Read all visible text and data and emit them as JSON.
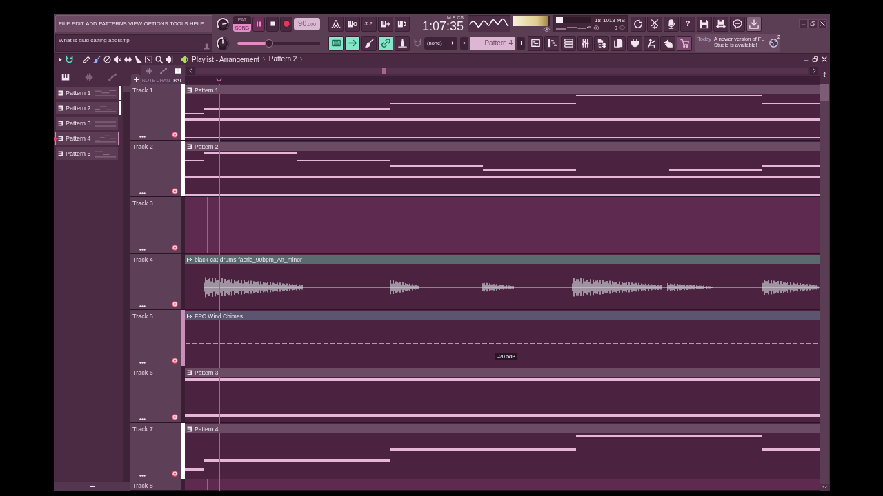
{
  "menu": [
    "FILE",
    "EDIT",
    "ADD",
    "PATTERNS",
    "VIEW",
    "OPTIONS",
    "TOOLS",
    "HELP"
  ],
  "hint_bar": {
    "text": "What is blud catting about.flp"
  },
  "knobs": [
    {
      "level": 0.8
    },
    {
      "level": 0.5
    }
  ],
  "transport": {
    "modes": [
      {
        "label": "PAT",
        "selected": false
      },
      {
        "label": "SONG",
        "selected": true
      }
    ],
    "tempo": {
      "whole": "90",
      "fraction": ".000"
    }
  },
  "pitch_slider": {
    "level": 0.38
  },
  "record_tools": [
    {
      "kind": "peak"
    },
    {
      "kind": "keys-loop"
    },
    {
      "kind": "countdown",
      "label": "3.2:"
    },
    {
      "kind": "keys-plus"
    },
    {
      "kind": "keys-cycle"
    }
  ],
  "toggles": [
    {
      "kind": "keyboard",
      "on": true
    },
    {
      "kind": "arrow",
      "on": true
    },
    {
      "kind": "brush",
      "on": false
    },
    {
      "kind": "link",
      "on": true
    },
    {
      "kind": "metronome",
      "on": false
    }
  ],
  "snap": {
    "value": "(none)"
  },
  "time": {
    "unit": "M:S:CS",
    "value": "1:07:35"
  },
  "meter": [
    {
      "level": 0.93
    },
    {
      "level": 0.93
    }
  ],
  "monitor": {
    "cpu": {
      "level": 0.2
    },
    "reading_1": "18",
    "memory": "1013 MB",
    "reading_2": "9"
  },
  "system_buttons": [
    {
      "kind": "refresh",
      "highlighted": false
    },
    {
      "kind": "cut",
      "highlighted": false
    },
    {
      "kind": "mic",
      "highlighted": false
    },
    {
      "kind": "help",
      "label": "?",
      "highlighted": false
    },
    {
      "kind": "save",
      "highlighted": false
    },
    {
      "kind": "save-as",
      "highlighted": false
    },
    {
      "kind": "chat",
      "highlighted": false
    },
    {
      "kind": "download",
      "highlighted": true
    }
  ],
  "pattern_selector": {
    "value": "Pattern 4"
  },
  "window_buttons": [
    {
      "kind": "playlist",
      "highlighted": false
    },
    {
      "kind": "piano-roll",
      "highlighted": false
    },
    {
      "kind": "channel-rack",
      "highlighted": false
    },
    {
      "kind": "mixer",
      "highlighted": false
    },
    {
      "kind": "browser",
      "highlighted": false
    },
    {
      "kind": "plugins",
      "highlighted": false
    },
    {
      "kind": "plug",
      "highlighted": false
    },
    {
      "kind": "touch",
      "highlighted": false
    },
    {
      "kind": "hand",
      "highlighted": false
    },
    {
      "kind": "cart",
      "highlighted": true
    }
  ],
  "news": {
    "date": "Today",
    "message": "A newer version of FL Studio is available!",
    "count": "2"
  },
  "playlist": {
    "tools": [
      {
        "kind": "pencil",
        "selected": false
      },
      {
        "kind": "brush",
        "selected": true
      },
      {
        "kind": "delete",
        "selected": false
      },
      {
        "kind": "mute",
        "selected": false
      },
      {
        "kind": "slip",
        "selected": false
      },
      {
        "kind": "slice",
        "selected": false
      },
      {
        "kind": "select",
        "selected": false
      },
      {
        "kind": "zoom",
        "selected": false
      },
      {
        "kind": "playback",
        "selected": false
      }
    ],
    "title": "Playlist - Arrangement",
    "breadcrumb": "Pattern 2"
  },
  "picker": {
    "tabs": [
      {
        "kind": "patterns",
        "selected": true
      },
      {
        "kind": "audio",
        "selected": false
      },
      {
        "kind": "automation",
        "selected": false
      }
    ],
    "items": [
      {
        "name": "Pattern 1",
        "selected": false,
        "marked": true
      },
      {
        "name": "Pattern 2",
        "selected": false,
        "marked": true
      },
      {
        "name": "Pattern 3",
        "selected": false,
        "marked": false
      },
      {
        "name": "Pattern 4",
        "selected": true,
        "marked": false
      },
      {
        "name": "Pattern 5",
        "selected": false,
        "marked": false
      }
    ]
  },
  "filters": [
    {
      "kind": "note",
      "label": "NOTE",
      "selected": false
    },
    {
      "kind": "channel",
      "label": "CHAN",
      "selected": false
    },
    {
      "kind": "pattern",
      "label": "PAT",
      "selected": true
    }
  ],
  "tracks": [
    {
      "name": "Track 1",
      "color": "#ffffff",
      "highlighted": false,
      "clip": {
        "kind": "pattern",
        "name": "Pattern 1"
      }
    },
    {
      "name": "Track 2",
      "color": "#ffffff",
      "highlighted": false,
      "clip": {
        "kind": "pattern",
        "name": "Pattern 2"
      }
    },
    {
      "name": "Track 3",
      "color": "#3a1f33",
      "highlighted": true
    },
    {
      "name": "Track 4",
      "color": "#3a1f33",
      "highlighted": false,
      "clip": {
        "kind": "audio",
        "name": "black-cat-drums-fabric_90bpm_A#_minor"
      }
    },
    {
      "name": "Track 5",
      "color": "#c98fb8",
      "highlighted": false,
      "clip": {
        "kind": "automation",
        "name": "FPC Wind Chimes",
        "hint": "-20.5dB"
      }
    },
    {
      "name": "Track 6",
      "color": "#3a1f33",
      "highlighted": false,
      "clip": {
        "kind": "pattern",
        "name": "Pattern 3"
      }
    },
    {
      "name": "Track 7",
      "color": "#ffffff",
      "highlighted": false,
      "clip": {
        "kind": "pattern",
        "name": "Pattern 4"
      }
    },
    {
      "name": "Track 8",
      "color": "#3a1f33",
      "highlighted": true
    }
  ]
}
